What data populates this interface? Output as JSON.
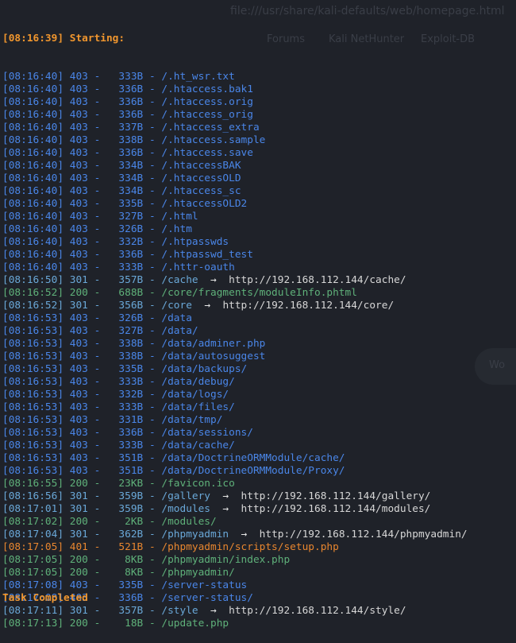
{
  "background": {
    "url_ghost": "file:///usr/share/kali-defaults/web/homepage.html",
    "bookmarks_ghost": [
      "Forums",
      "Kali NetHunter",
      "Exploit-DB"
    ],
    "bubble_ghost": "Wo"
  },
  "terminal": {
    "start_line": "[08:16:39] Starting:",
    "lines": [
      {
        "ts": "[08:16:40]",
        "code": "403",
        "size": "333B",
        "path": "/.ht_wsr.txt",
        "redirect": ""
      },
      {
        "ts": "[08:16:40]",
        "code": "403",
        "size": "336B",
        "path": "/.htaccess.bak1",
        "redirect": ""
      },
      {
        "ts": "[08:16:40]",
        "code": "403",
        "size": "336B",
        "path": "/.htaccess.orig",
        "redirect": ""
      },
      {
        "ts": "[08:16:40]",
        "code": "403",
        "size": "336B",
        "path": "/.htaccess_orig",
        "redirect": ""
      },
      {
        "ts": "[08:16:40]",
        "code": "403",
        "size": "337B",
        "path": "/.htaccess_extra",
        "redirect": ""
      },
      {
        "ts": "[08:16:40]",
        "code": "403",
        "size": "338B",
        "path": "/.htaccess.sample",
        "redirect": ""
      },
      {
        "ts": "[08:16:40]",
        "code": "403",
        "size": "336B",
        "path": "/.htaccess.save",
        "redirect": ""
      },
      {
        "ts": "[08:16:40]",
        "code": "403",
        "size": "334B",
        "path": "/.htaccessBAK",
        "redirect": ""
      },
      {
        "ts": "[08:16:40]",
        "code": "403",
        "size": "334B",
        "path": "/.htaccessOLD",
        "redirect": ""
      },
      {
        "ts": "[08:16:40]",
        "code": "403",
        "size": "334B",
        "path": "/.htaccess_sc",
        "redirect": ""
      },
      {
        "ts": "[08:16:40]",
        "code": "403",
        "size": "335B",
        "path": "/.htaccessOLD2",
        "redirect": ""
      },
      {
        "ts": "[08:16:40]",
        "code": "403",
        "size": "327B",
        "path": "/.html",
        "redirect": ""
      },
      {
        "ts": "[08:16:40]",
        "code": "403",
        "size": "326B",
        "path": "/.htm",
        "redirect": ""
      },
      {
        "ts": "[08:16:40]",
        "code": "403",
        "size": "332B",
        "path": "/.htpasswds",
        "redirect": ""
      },
      {
        "ts": "[08:16:40]",
        "code": "403",
        "size": "336B",
        "path": "/.htpasswd_test",
        "redirect": ""
      },
      {
        "ts": "[08:16:40]",
        "code": "403",
        "size": "333B",
        "path": "/.httr-oauth",
        "redirect": ""
      },
      {
        "ts": "[08:16:50]",
        "code": "301",
        "size": "357B",
        "path": "/cache",
        "redirect": "http://192.168.112.144/cache/"
      },
      {
        "ts": "[08:16:52]",
        "code": "200",
        "size": "688B",
        "path": "/core/fragments/moduleInfo.phtml",
        "redirect": ""
      },
      {
        "ts": "[08:16:52]",
        "code": "301",
        "size": "356B",
        "path": "/core",
        "redirect": "http://192.168.112.144/core/"
      },
      {
        "ts": "[08:16:53]",
        "code": "403",
        "size": "326B",
        "path": "/data",
        "redirect": ""
      },
      {
        "ts": "[08:16:53]",
        "code": "403",
        "size": "327B",
        "path": "/data/",
        "redirect": ""
      },
      {
        "ts": "[08:16:53]",
        "code": "403",
        "size": "338B",
        "path": "/data/adminer.php",
        "redirect": ""
      },
      {
        "ts": "[08:16:53]",
        "code": "403",
        "size": "338B",
        "path": "/data/autosuggest",
        "redirect": ""
      },
      {
        "ts": "[08:16:53]",
        "code": "403",
        "size": "335B",
        "path": "/data/backups/",
        "redirect": ""
      },
      {
        "ts": "[08:16:53]",
        "code": "403",
        "size": "333B",
        "path": "/data/debug/",
        "redirect": ""
      },
      {
        "ts": "[08:16:53]",
        "code": "403",
        "size": "332B",
        "path": "/data/logs/",
        "redirect": ""
      },
      {
        "ts": "[08:16:53]",
        "code": "403",
        "size": "333B",
        "path": "/data/files/",
        "redirect": ""
      },
      {
        "ts": "[08:16:53]",
        "code": "403",
        "size": "331B",
        "path": "/data/tmp/",
        "redirect": ""
      },
      {
        "ts": "[08:16:53]",
        "code": "403",
        "size": "336B",
        "path": "/data/sessions/",
        "redirect": ""
      },
      {
        "ts": "[08:16:53]",
        "code": "403",
        "size": "333B",
        "path": "/data/cache/",
        "redirect": ""
      },
      {
        "ts": "[08:16:53]",
        "code": "403",
        "size": "351B",
        "path": "/data/DoctrineORMModule/cache/",
        "redirect": ""
      },
      {
        "ts": "[08:16:53]",
        "code": "403",
        "size": "351B",
        "path": "/data/DoctrineORMModule/Proxy/",
        "redirect": ""
      },
      {
        "ts": "[08:16:55]",
        "code": "200",
        "size": "23KB",
        "path": "/favicon.ico",
        "redirect": ""
      },
      {
        "ts": "[08:16:56]",
        "code": "301",
        "size": "359B",
        "path": "/gallery",
        "redirect": "http://192.168.112.144/gallery/"
      },
      {
        "ts": "[08:17:01]",
        "code": "301",
        "size": "359B",
        "path": "/modules",
        "redirect": "http://192.168.112.144/modules/"
      },
      {
        "ts": "[08:17:02]",
        "code": "200",
        "size": "2KB",
        "path": "/modules/",
        "redirect": ""
      },
      {
        "ts": "[08:17:04]",
        "code": "301",
        "size": "362B",
        "path": "/phpmyadmin",
        "redirect": "http://192.168.112.144/phpmyadmin/"
      },
      {
        "ts": "[08:17:05]",
        "code": "401",
        "size": "521B",
        "path": "/phpmyadmin/scripts/setup.php",
        "redirect": ""
      },
      {
        "ts": "[08:17:05]",
        "code": "200",
        "size": "8KB",
        "path": "/phpmyadmin/index.php",
        "redirect": ""
      },
      {
        "ts": "[08:17:05]",
        "code": "200",
        "size": "8KB",
        "path": "/phpmyadmin/",
        "redirect": ""
      },
      {
        "ts": "[08:17:08]",
        "code": "403",
        "size": "335B",
        "path": "/server-status",
        "redirect": ""
      },
      {
        "ts": "[08:17:08]",
        "code": "403",
        "size": "336B",
        "path": "/server-status/",
        "redirect": ""
      },
      {
        "ts": "[08:17:11]",
        "code": "301",
        "size": "357B",
        "path": "/style",
        "redirect": "http://192.168.112.144/style/"
      },
      {
        "ts": "[08:17:13]",
        "code": "200",
        "size": "18B",
        "path": "/update.php",
        "redirect": ""
      }
    ],
    "end_line": "Task Completed",
    "colors": {
      "403": "#4a86e8",
      "301": "#6aa8d8",
      "200": "#5fb17a",
      "401": "#e8862f",
      "accent": "#f0962e"
    }
  }
}
